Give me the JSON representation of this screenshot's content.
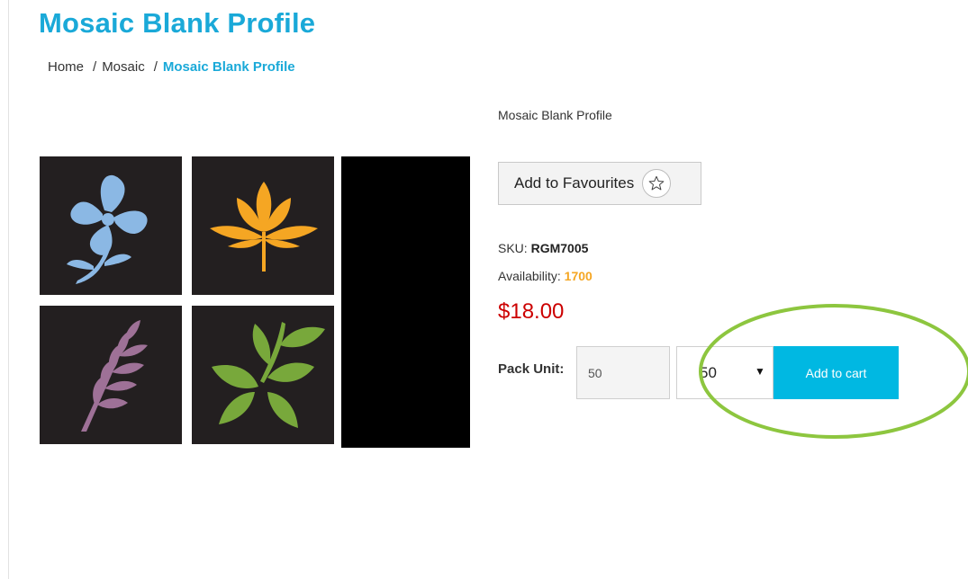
{
  "page": {
    "title": "Mosaic Blank Profile"
  },
  "breadcrumb": {
    "items": [
      "Home",
      "Mosaic",
      "Mosaic Blank Profile"
    ],
    "separator": "/"
  },
  "product": {
    "subtitle": "Mosaic Blank Profile",
    "favourite_label": "Add to Favourites",
    "favourite_icon": "star-outline-icon",
    "sku_label": "SKU:",
    "sku": "RGM7005",
    "availability_label": "Availability:",
    "availability": "1700",
    "price": "$18.00",
    "pack_unit_label": "Pack Unit:",
    "pack_unit_value": "50",
    "pack_unit_selected": "50",
    "add_to_cart_label": "Add to cart"
  },
  "colors": {
    "title": "#1aa9d8",
    "price": "#cc0000",
    "availability": "#f5a623",
    "cart_button": "#00b8e2",
    "highlight": "#8dc63f",
    "tile_flower": "#8bb8e4",
    "tile_fan": "#f5a623",
    "tile_fern": "#9e7197",
    "tile_leaves": "#78a83b"
  }
}
